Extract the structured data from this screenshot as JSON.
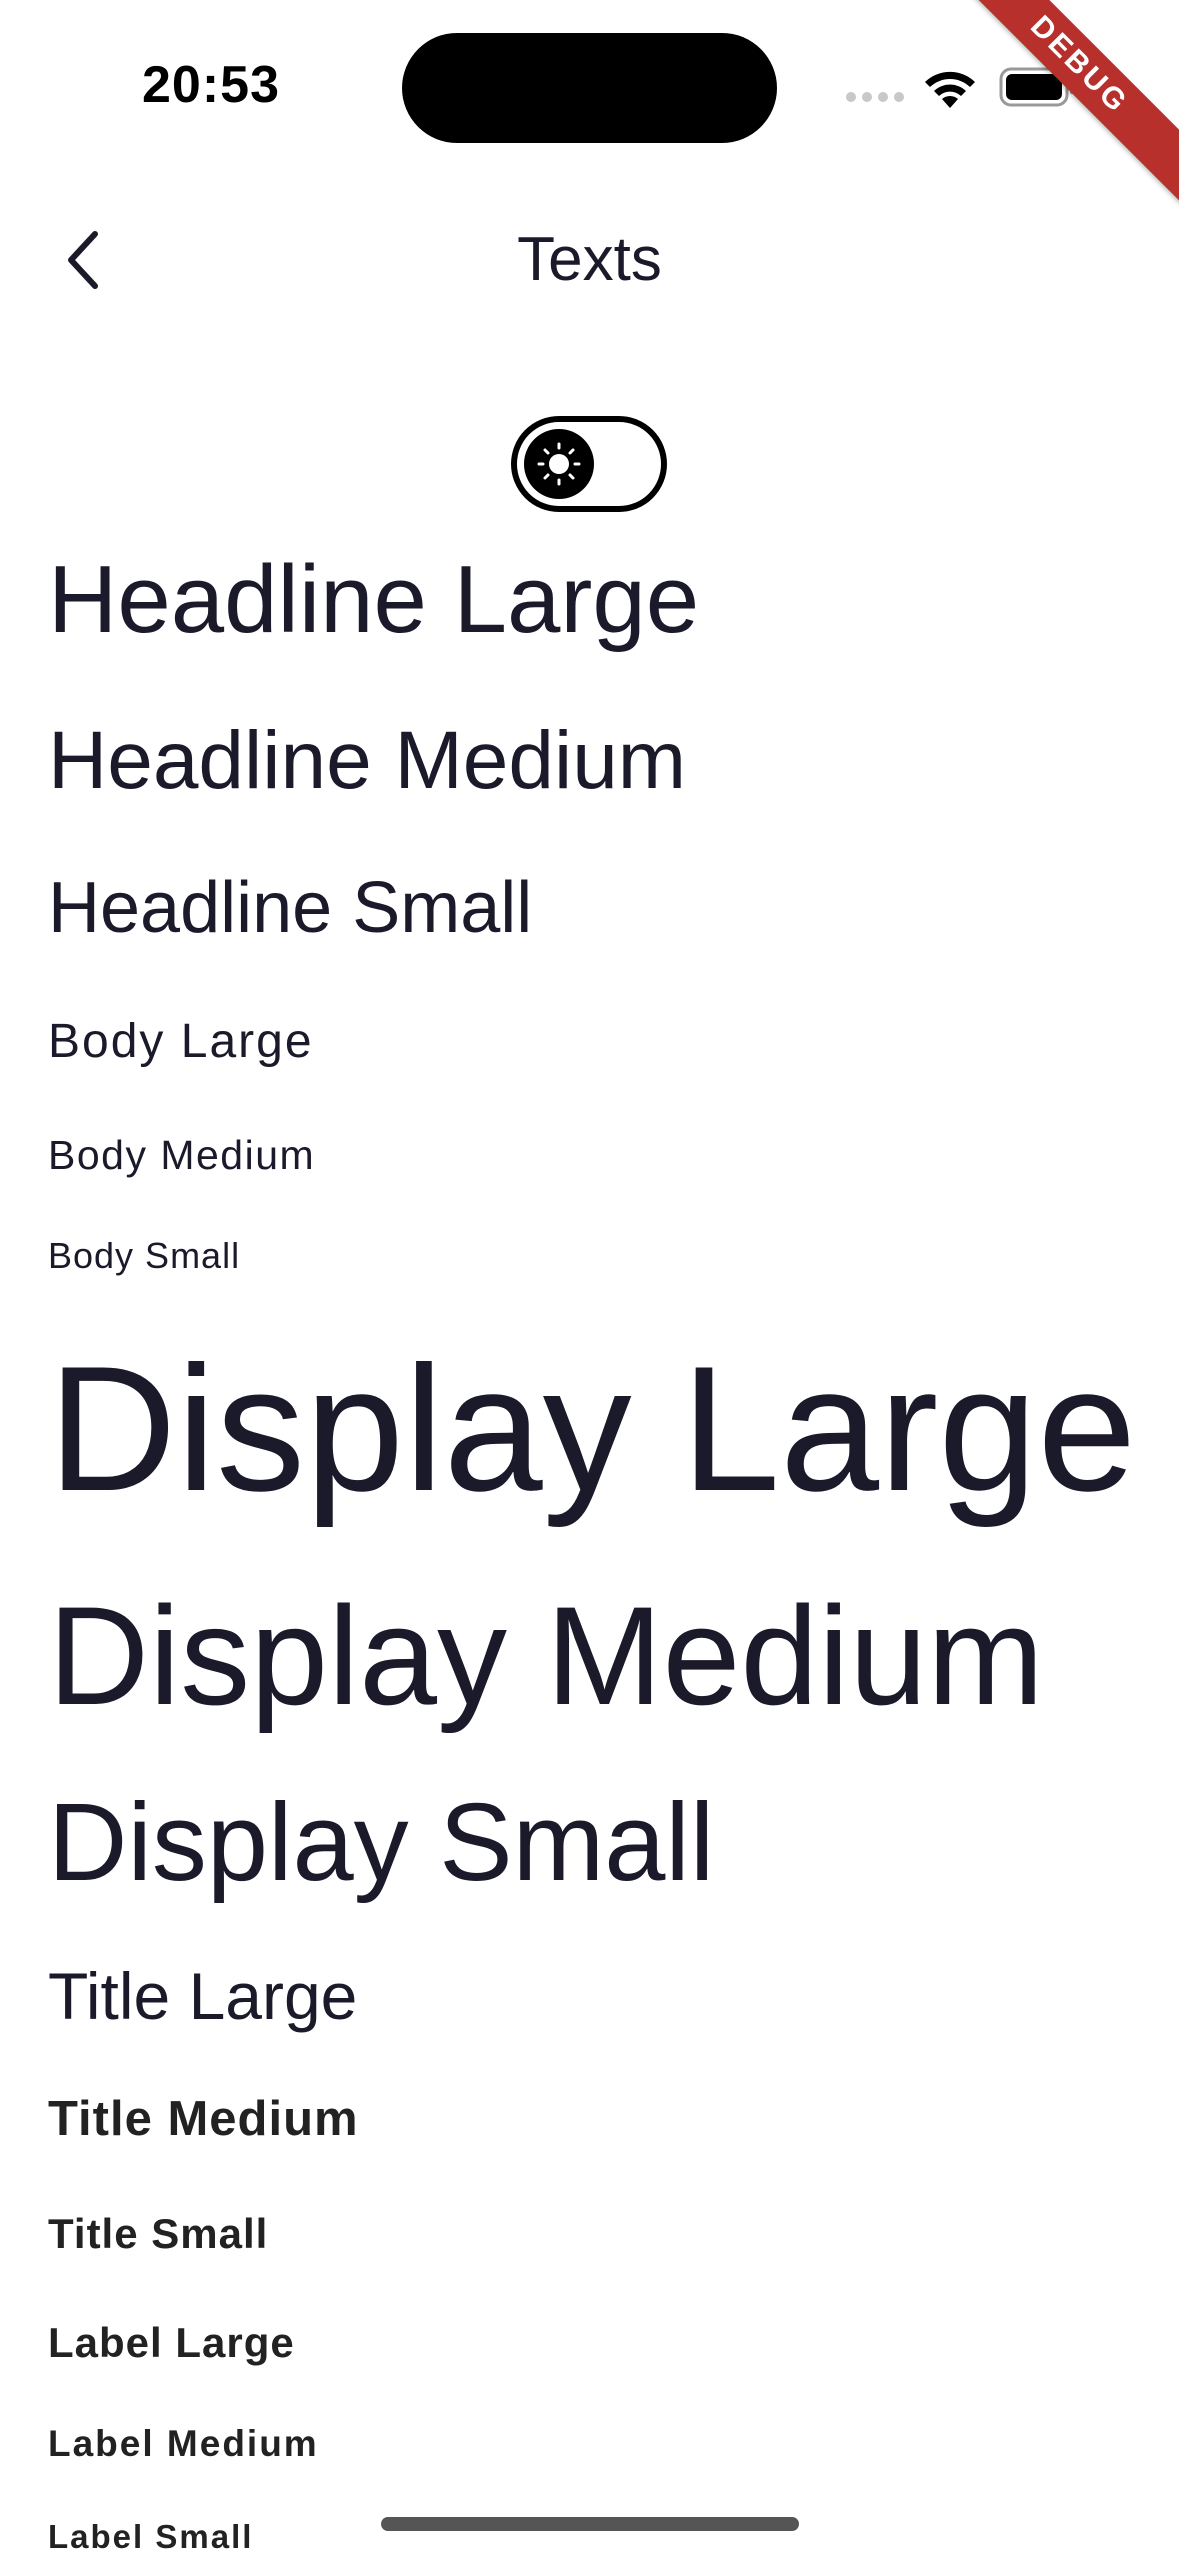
{
  "status_bar": {
    "time": "20:53",
    "wifi_icon": "wifi-icon",
    "battery_icon": "battery-icon"
  },
  "debug_banner": "DEBUG",
  "app_bar": {
    "back_icon": "chevron-left-icon",
    "title": "Texts"
  },
  "theme_toggle": {
    "icon": "sun-icon",
    "state": "off"
  },
  "texts": {
    "headline_large": "Headline Large",
    "headline_medium": "Headline Medium",
    "headline_small": "Headline Small",
    "body_large": "Body Large",
    "body_medium": "Body Medium",
    "body_small": "Body Small",
    "display_large": "Display Large",
    "display_medium": "Display Medium",
    "display_small": "Display Small",
    "title_large": "Title Large",
    "title_medium": "Title Medium",
    "title_small": "Title Small",
    "label_large": "Label Large",
    "label_medium": "Label Medium",
    "label_small": "Label Small"
  },
  "colors": {
    "text": "#1a1a2a",
    "debug_ribbon": "#b8302c",
    "background": "#ffffff"
  }
}
